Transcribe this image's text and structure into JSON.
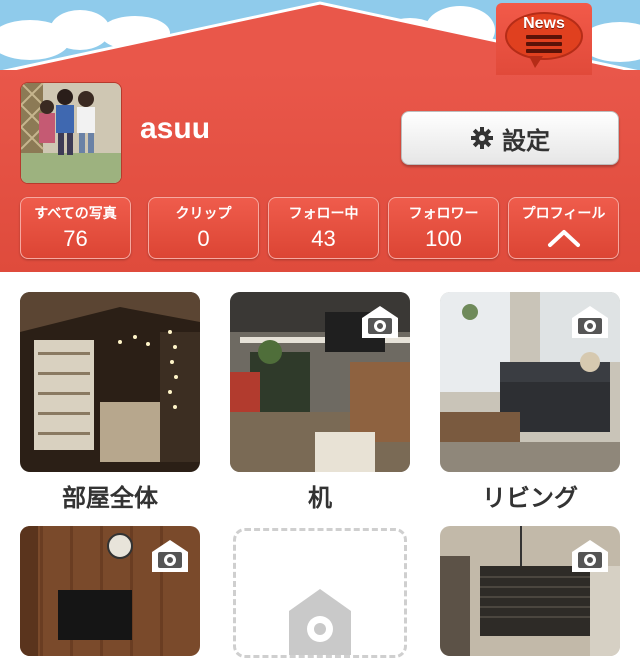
{
  "header": {
    "news_label": "News",
    "username": "asuu",
    "settings_label": "設定"
  },
  "stats": [
    {
      "title": "すべての写真",
      "count": "76"
    },
    {
      "title": "クリップ",
      "count": "0"
    },
    {
      "title": "フォロー中",
      "count": "43"
    },
    {
      "title": "フォロワー",
      "count": "100"
    }
  ],
  "profile_tab": {
    "title": "プロフィール"
  },
  "rooms": [
    {
      "label": "部屋全体"
    },
    {
      "label": "机"
    },
    {
      "label": "リビング"
    }
  ],
  "colors": {
    "brand_red": "#e9574a",
    "sky": "#8fcbeb"
  }
}
